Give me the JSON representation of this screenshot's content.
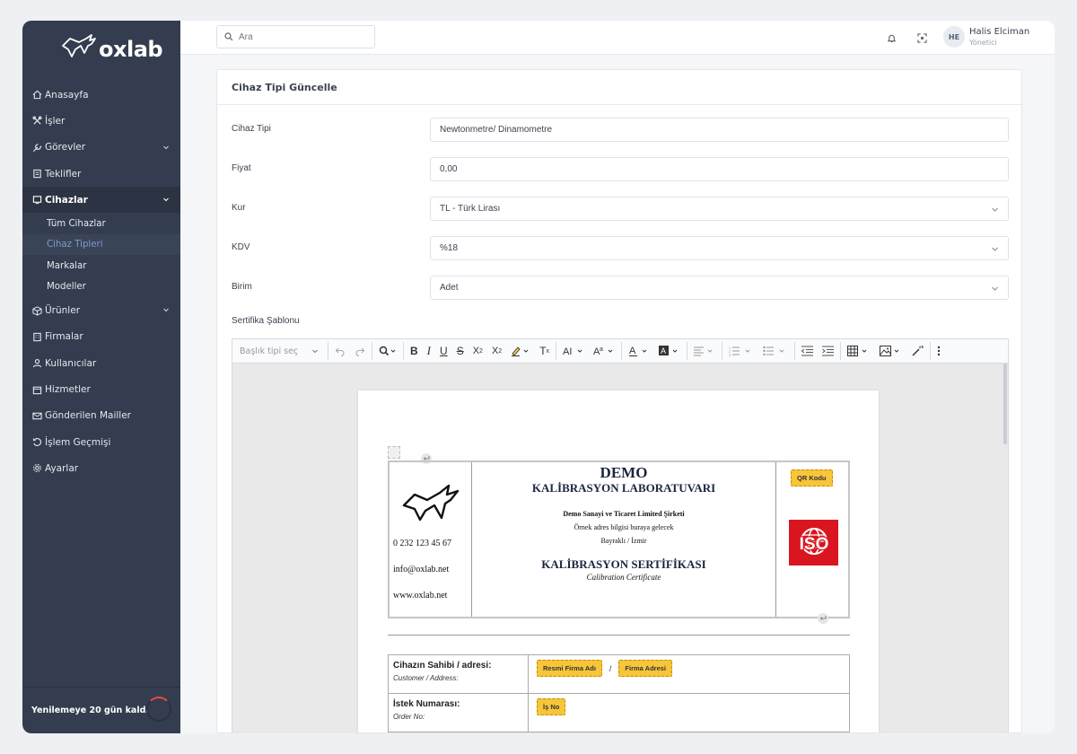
{
  "brand": {
    "name": "oxlab"
  },
  "sidebar": {
    "items": [
      {
        "label": "Anasayfa",
        "icon": "home-icon"
      },
      {
        "label": "İşler",
        "icon": "tools-icon"
      },
      {
        "label": "Görevler",
        "icon": "wrench-icon"
      },
      {
        "label": "Teklifler",
        "icon": "receipt-icon"
      },
      {
        "label": "Cihazlar",
        "icon": "device-icon"
      },
      {
        "label": "Ürünler",
        "icon": "box-icon"
      },
      {
        "label": "Firmalar",
        "icon": "building-icon"
      },
      {
        "label": "Kullanıcılar",
        "icon": "user-icon"
      },
      {
        "label": "Hizmetler",
        "icon": "calendar-icon"
      },
      {
        "label": "Gönderilen Mailler",
        "icon": "mail-icon"
      },
      {
        "label": "İşlem Geçmişi",
        "icon": "history-icon"
      },
      {
        "label": "Ayarlar",
        "icon": "gear-icon"
      }
    ],
    "subitems": [
      "Tüm Cihazlar",
      "Cihaz Tipleri",
      "Markalar",
      "Modeller"
    ],
    "renewal": "Yenilemeye 20 gün kaldı"
  },
  "topbar": {
    "search_placeholder": "Ara",
    "user_initials": "HE",
    "user_name": "Halis Elciman",
    "user_role": "Yönetici"
  },
  "form": {
    "title": "Cihaz Tipi Güncelle",
    "fields": [
      {
        "label": "Cihaz Tipi",
        "value": "Newtonmetre/ Dinamometre"
      },
      {
        "label": "Fiyat",
        "value": "0,00"
      },
      {
        "label": "Kur",
        "value": "TL - Türk Lirası"
      },
      {
        "label": "KDV",
        "value": "%18"
      },
      {
        "label": "Birim",
        "value": "Adet"
      }
    ],
    "template_label": "Sertifika Şablonu"
  },
  "editor": {
    "heading_placeholder": "Başlık tipi seç",
    "doc": {
      "title": "DEMO",
      "lab": "KALİBRASYON LABORATUVARI",
      "company": "Demo Sanayi ve Ticaret Limited Şirketi",
      "address": "Örnek adres bilgisi buraya gelecek",
      "city": "Bayraklı / İzmir",
      "cert_title": "KALİBRASYON SERTİFİKASI",
      "cert_sub": "Calibration Certificate",
      "phone": "0 232 123 45 67",
      "email": "info@oxlab.net",
      "web": "www.oxlab.net",
      "qr_chip": "QR Kodu",
      "iso": "ISO",
      "rows": [
        {
          "main": "Cihazın Sahibi / adresi:",
          "sub": "Customer / Address:",
          "chips": [
            "Resmi Firma Adı",
            "Firma Adresi"
          ],
          "sep": "/"
        },
        {
          "main": "İstek Numarası:",
          "sub": "Order No:",
          "chips": [
            "İş No"
          ]
        }
      ]
    }
  }
}
